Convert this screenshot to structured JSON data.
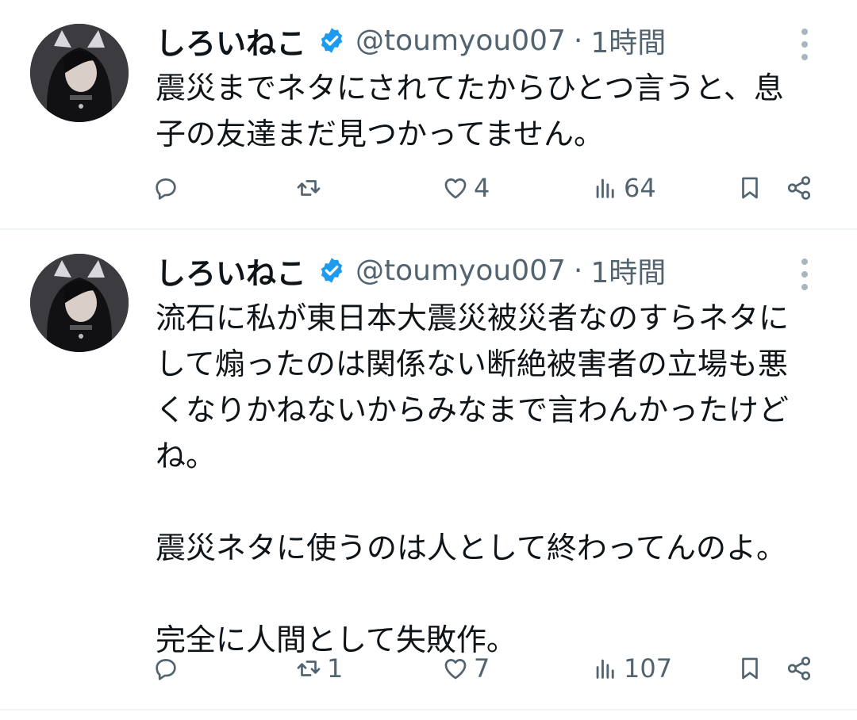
{
  "tweets": [
    {
      "display_name": "しろいねこ",
      "handle": "@toumyou007",
      "separator": "·",
      "time": "1時間",
      "text": "震災までネタにされてたからひとつ言うと、息\n子の友達まだ見つかってません。",
      "reply_count": "",
      "retweet_count": "",
      "like_count": "4",
      "view_count": "64"
    },
    {
      "display_name": "しろいねこ",
      "handle": "@toumyou007",
      "separator": "·",
      "time": "1時間",
      "text": "流石に私が東日本大震災被災者なのすらネタに\nして煽ったのは関係ない断絶被害者の立場も悪\nくなりかねないからみなまで言わんかったけど\nね。\n\n震災ネタに使うのは人として終わってんのよ。\n\n完全に人間として失敗作。",
      "reply_count": "",
      "retweet_count": "1",
      "like_count": "7",
      "view_count": "107"
    }
  ],
  "icons": {
    "verified": "verified-badge-icon",
    "more": "more-options-icon",
    "reply": "reply-icon",
    "retweet": "retweet-icon",
    "like": "heart-icon",
    "views": "views-bar-chart-icon",
    "bookmark": "bookmark-icon",
    "share": "share-icon"
  },
  "colors": {
    "verified_blue": "#1d9bf0",
    "secondary_text": "#536471",
    "primary_text": "#0f1419",
    "divider": "#eff3f4"
  }
}
